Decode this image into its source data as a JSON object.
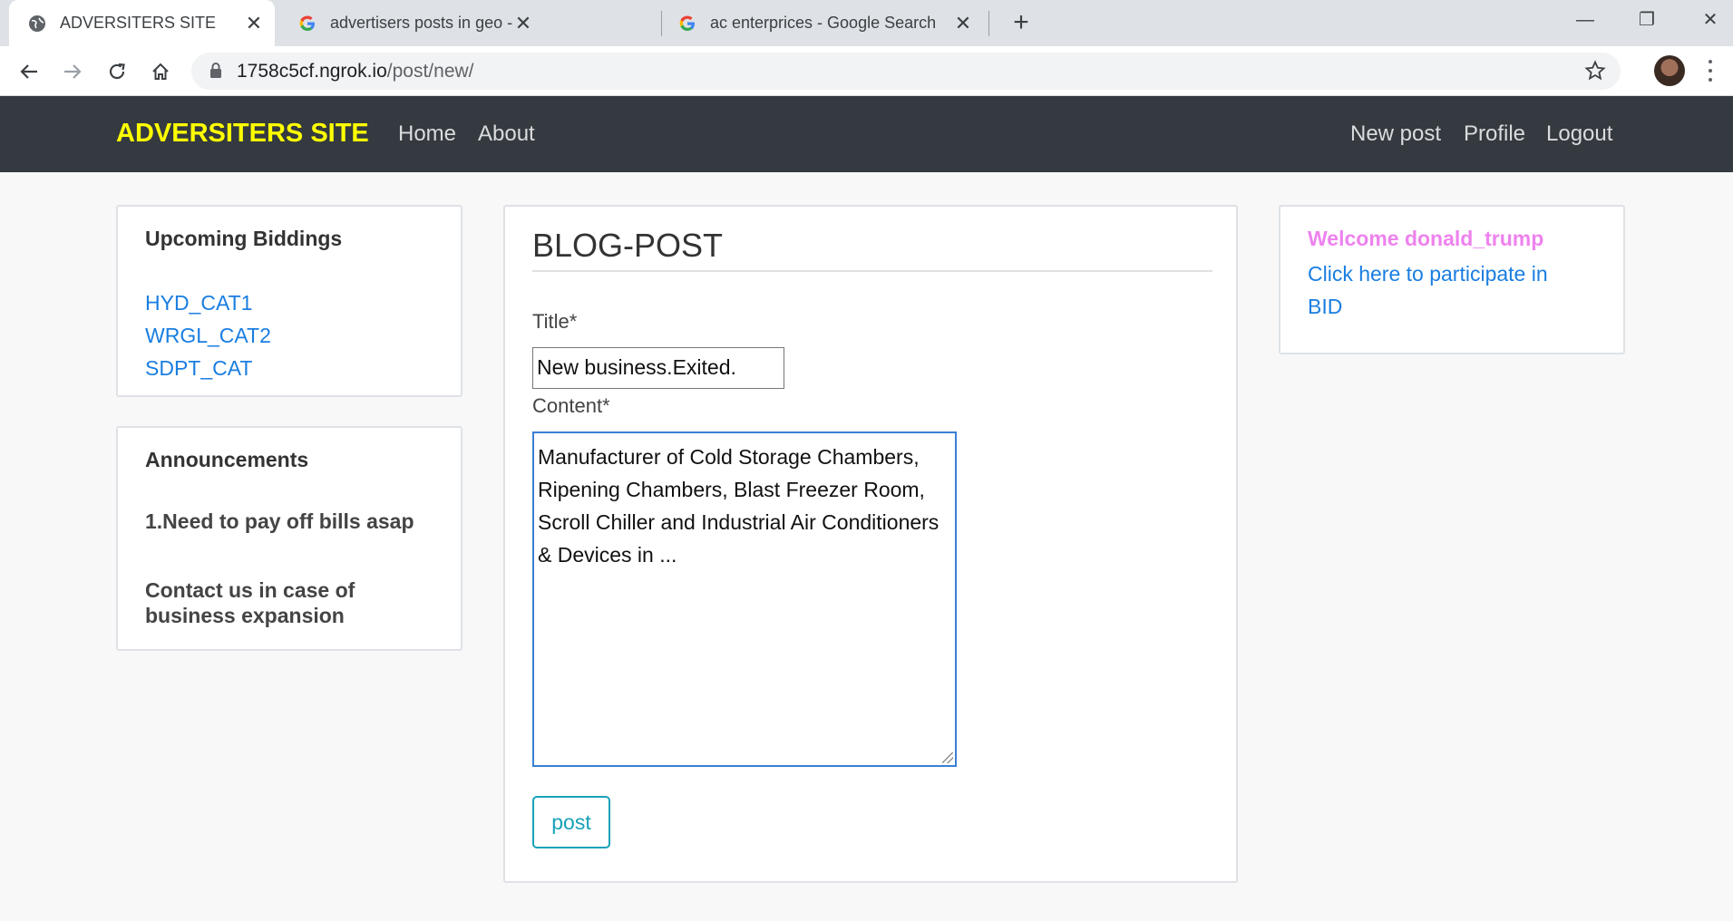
{
  "browser": {
    "tabs": [
      {
        "title": "ADVERSITERS SITE",
        "favicon": "globe-icon",
        "active": true
      },
      {
        "title": "advertisers posts in geo -advertis",
        "favicon": "google-icon",
        "active": false
      },
      {
        "title": "ac enterprices - Google Search",
        "favicon": "google-icon",
        "active": false
      }
    ],
    "url_host": "1758c5cf.ngrok.io",
    "url_path": "/post/new/"
  },
  "navbar": {
    "brand": "ADVERSITERS SITE",
    "left_links": [
      "Home",
      "About"
    ],
    "right_links": [
      "New post",
      "Profile",
      "Logout"
    ],
    "brand_color": "#ffff00",
    "background": "#343a40"
  },
  "left_sidebar": {
    "biddings": {
      "heading": "Upcoming Biddings",
      "links": [
        "HYD_CAT1",
        "WRGL_CAT2",
        "SDPT_CAT"
      ]
    },
    "announcements": {
      "heading": "Announcements",
      "items": [
        "1.Need to pay off bills asap",
        "Contact us in case of business expansion"
      ]
    }
  },
  "form": {
    "legend": "BLOG-POST",
    "title_label": "Title*",
    "title_value": "New business.Exited.",
    "content_label": "Content*",
    "content_value": "Manufacturer of Cold Storage Chambers, Ripening Chambers, Blast Freezer Room, Scroll Chiller and Industrial Air Conditioners & Devices in ...",
    "submit_label": "post"
  },
  "right_sidebar": {
    "welcome": "Welcome donald_trump",
    "welcome_color": "#ee82ee",
    "participate_link": "Click here to participate in BID"
  }
}
